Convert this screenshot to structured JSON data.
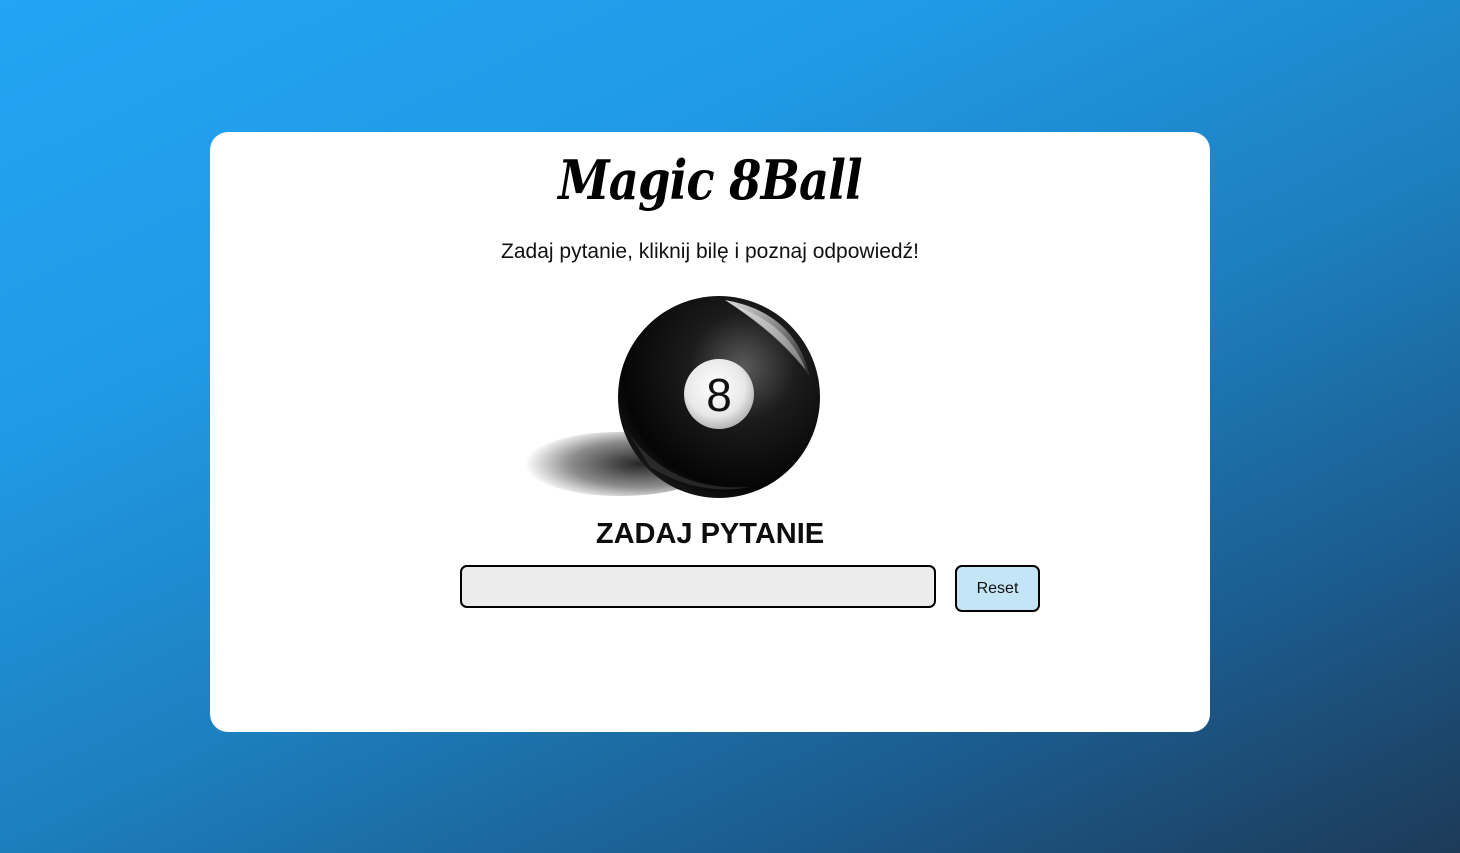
{
  "header": {
    "title": "Magic 8Ball",
    "subtitle": "Zadaj pytanie, kliknij bilę i poznaj odpowiedź!"
  },
  "ball": {
    "number": "8",
    "icon": "eight-ball-icon"
  },
  "form": {
    "heading": "ZADAJ PYTANIE",
    "question_value": "",
    "question_placeholder": "",
    "reset_label": "Reset"
  },
  "colors": {
    "background_start": "#22a5f3",
    "background_end": "#1d3a58",
    "card": "#ffffff",
    "input_bg": "#ececec",
    "reset_bg": "#c4e5f5"
  }
}
